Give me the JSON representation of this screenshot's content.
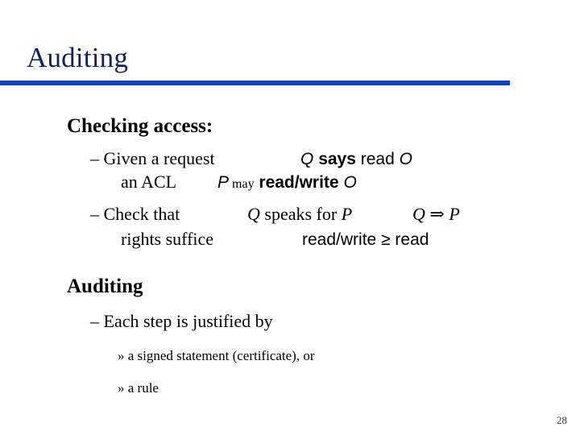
{
  "slide": {
    "title": "Auditing",
    "page_number": "28",
    "accent_color": "#1340bf",
    "title_color": "#13215e",
    "text_color": "#000000",
    "bullet_dash": "–",
    "bullet_guillemet": "»"
  },
  "sections": [
    {
      "heading": "Checking access:",
      "bullets": [
        {
          "marker": "–",
          "text": "Given  a request",
          "notation": {
            "parts": [
              {
                "text": "Q",
                "style": "sans-italic"
              },
              {
                "text": "says",
                "style": "sans-bold"
              },
              {
                "text": "read",
                "style": "sans"
              },
              {
                "text": "O",
                "style": "sans-italic"
              }
            ],
            "plain": "Q says read O"
          }
        },
        {
          "marker": "",
          "text": "an ACL",
          "notation": {
            "parts": [
              {
                "text": "P",
                "style": "sans-italic"
              },
              {
                "text": "may",
                "style": "serif"
              },
              {
                "text": "read/write",
                "style": "sans-bold"
              },
              {
                "text": "O",
                "style": "sans-italic"
              }
            ],
            "plain": "P may read/write O"
          }
        },
        {
          "marker": "–",
          "text": "Check that",
          "notation": {
            "parts": [
              {
                "text": "Q",
                "style": "serif-italic"
              },
              {
                "text": "speaks for",
                "style": "serif"
              },
              {
                "text": "P",
                "style": "serif-italic"
              }
            ],
            "plain": "Q speaks for P"
          },
          "notation2": {
            "parts": [
              {
                "text": "Q",
                "style": "serif-italic"
              },
              {
                "text": "⇒",
                "style": "serif"
              },
              {
                "text": "P",
                "style": "serif-italic"
              }
            ],
            "plain": "Q ⇒ P"
          }
        },
        {
          "marker": "",
          "text": "rights suffice",
          "notation": {
            "parts": [
              {
                "text": "read/write ≥ read",
                "style": "sans"
              }
            ],
            "plain": "read/write ≥ read"
          }
        }
      ]
    },
    {
      "heading": "Auditing",
      "bullets": [
        {
          "marker": "–",
          "text": "Each step is justified by",
          "notation": null
        }
      ],
      "subbullets": [
        {
          "marker": "»",
          "text": "a signed statement (certificate), or"
        },
        {
          "marker": "»",
          "text": "a rule"
        }
      ]
    }
  ],
  "lines": {
    "l1_lead": "– Given  a request",
    "l1_q": "Q",
    "l1_says": "says",
    "l1_read": "read",
    "l1_o": "O",
    "l2_lead": "an ACL",
    "l2_p": "P",
    "l2_may": "may",
    "l2_rw": "read/write",
    "l2_o": "O",
    "l3_lead": "– Check that",
    "l3_q": "Q",
    "l3_speaks": "speaks for",
    "l3_p": "P",
    "l3_q2": "Q",
    "l3_arrow": "⇒",
    "l3_p2": "P",
    "l4_lead": "rights suffice",
    "l4_rel": "read/write ≥ read",
    "l5": "– Each step is justified by",
    "l6": "» a signed statement (certificate), or",
    "l7": "» a rule",
    "h1": "Checking access:",
    "h2": "Auditing"
  }
}
